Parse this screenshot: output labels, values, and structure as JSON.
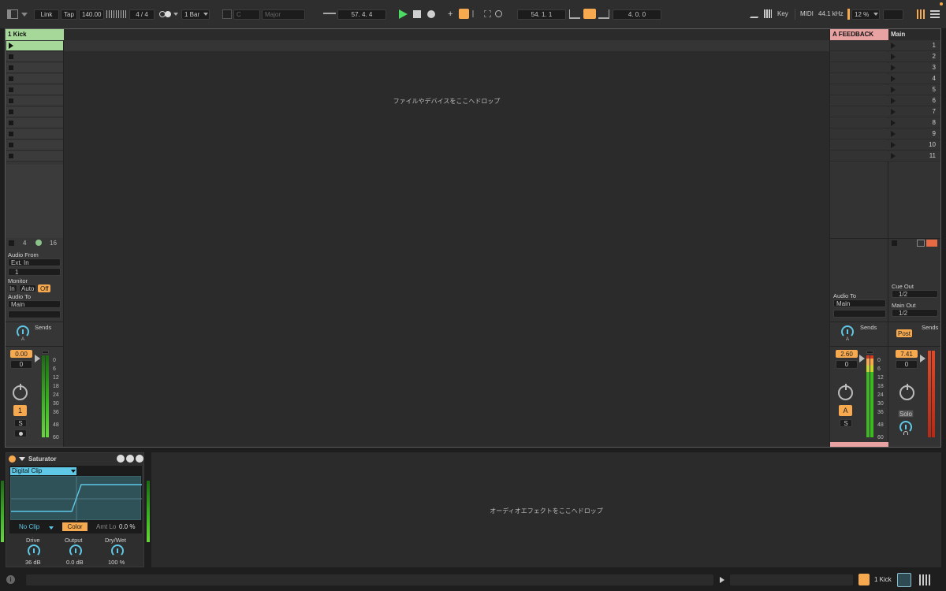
{
  "toolbar": {
    "link": "Link",
    "tap": "Tap",
    "tempo": "140.00",
    "time_sig": "4 / 4",
    "quantize": "1 Bar",
    "key": "C",
    "scale": "Major",
    "arrangement_position": "57.  4.  4",
    "loop_start": "54.  1.  1",
    "loop_length": "4.  0.  0",
    "key_map": "Key",
    "midi_map": "MIDI",
    "sample_rate": "44.1 kHz",
    "cpu": "12 %"
  },
  "tracks": {
    "kick": {
      "title": "1 Kick",
      "number": "1",
      "color": "#a6d89a"
    },
    "feedback": {
      "title": "A FEEDBACK",
      "letter": "A",
      "color": "#e7a2a1"
    },
    "main": {
      "title": "Main"
    }
  },
  "session": {
    "drop_hint": "ファイルやデバイスをここへドロップ",
    "scenes": [
      "1",
      "2",
      "3",
      "4",
      "5",
      "6",
      "7",
      "8",
      "9",
      "10",
      "11"
    ]
  },
  "io": {
    "input_label_1": "4",
    "input_label_2": "16",
    "audio_from": "Audio From",
    "audio_from_value": "Ext. In",
    "audio_from_channel": "1",
    "monitor": "Monitor",
    "monitor_in": "In",
    "monitor_auto": "Auto",
    "monitor_off": "Off",
    "audio_to": "Audio To",
    "audio_to_value": "Main",
    "return_audio_to": "Audio To",
    "return_audio_to_value": "Main",
    "cue_out": "Cue Out",
    "cue_out_value": "1/2",
    "main_out": "Main Out",
    "main_out_value": "1/2"
  },
  "mixer": {
    "sends": "Sends",
    "send_a_label": "A",
    "post": "Post",
    "solo": "Solo",
    "solo_short": "S",
    "kick_volume": "0.00",
    "kick_pan": "0",
    "return_volume": "2.60",
    "return_pan": "0",
    "main_volume": "7.41",
    "main_pan": "0",
    "scale": [
      "0",
      "6",
      "12",
      "18",
      "24",
      "30",
      "36",
      "48",
      "60"
    ]
  },
  "device": {
    "name": "Saturator",
    "mode": "Digital Clip",
    "clip": "No Clip",
    "color": "Color",
    "amt_lo_label": "Amt Lo",
    "amt_lo_value": "0.0 %",
    "drive_label": "Drive",
    "drive_value": "36 dB",
    "output_label": "Output",
    "output_value": "0.0 dB",
    "drywet_label": "Dry/Wet",
    "drywet_value": "100 %",
    "drop_hint": "オーディオエフェクトをここへドロップ"
  },
  "statusbar": {
    "selected_track": "1 Kick"
  }
}
